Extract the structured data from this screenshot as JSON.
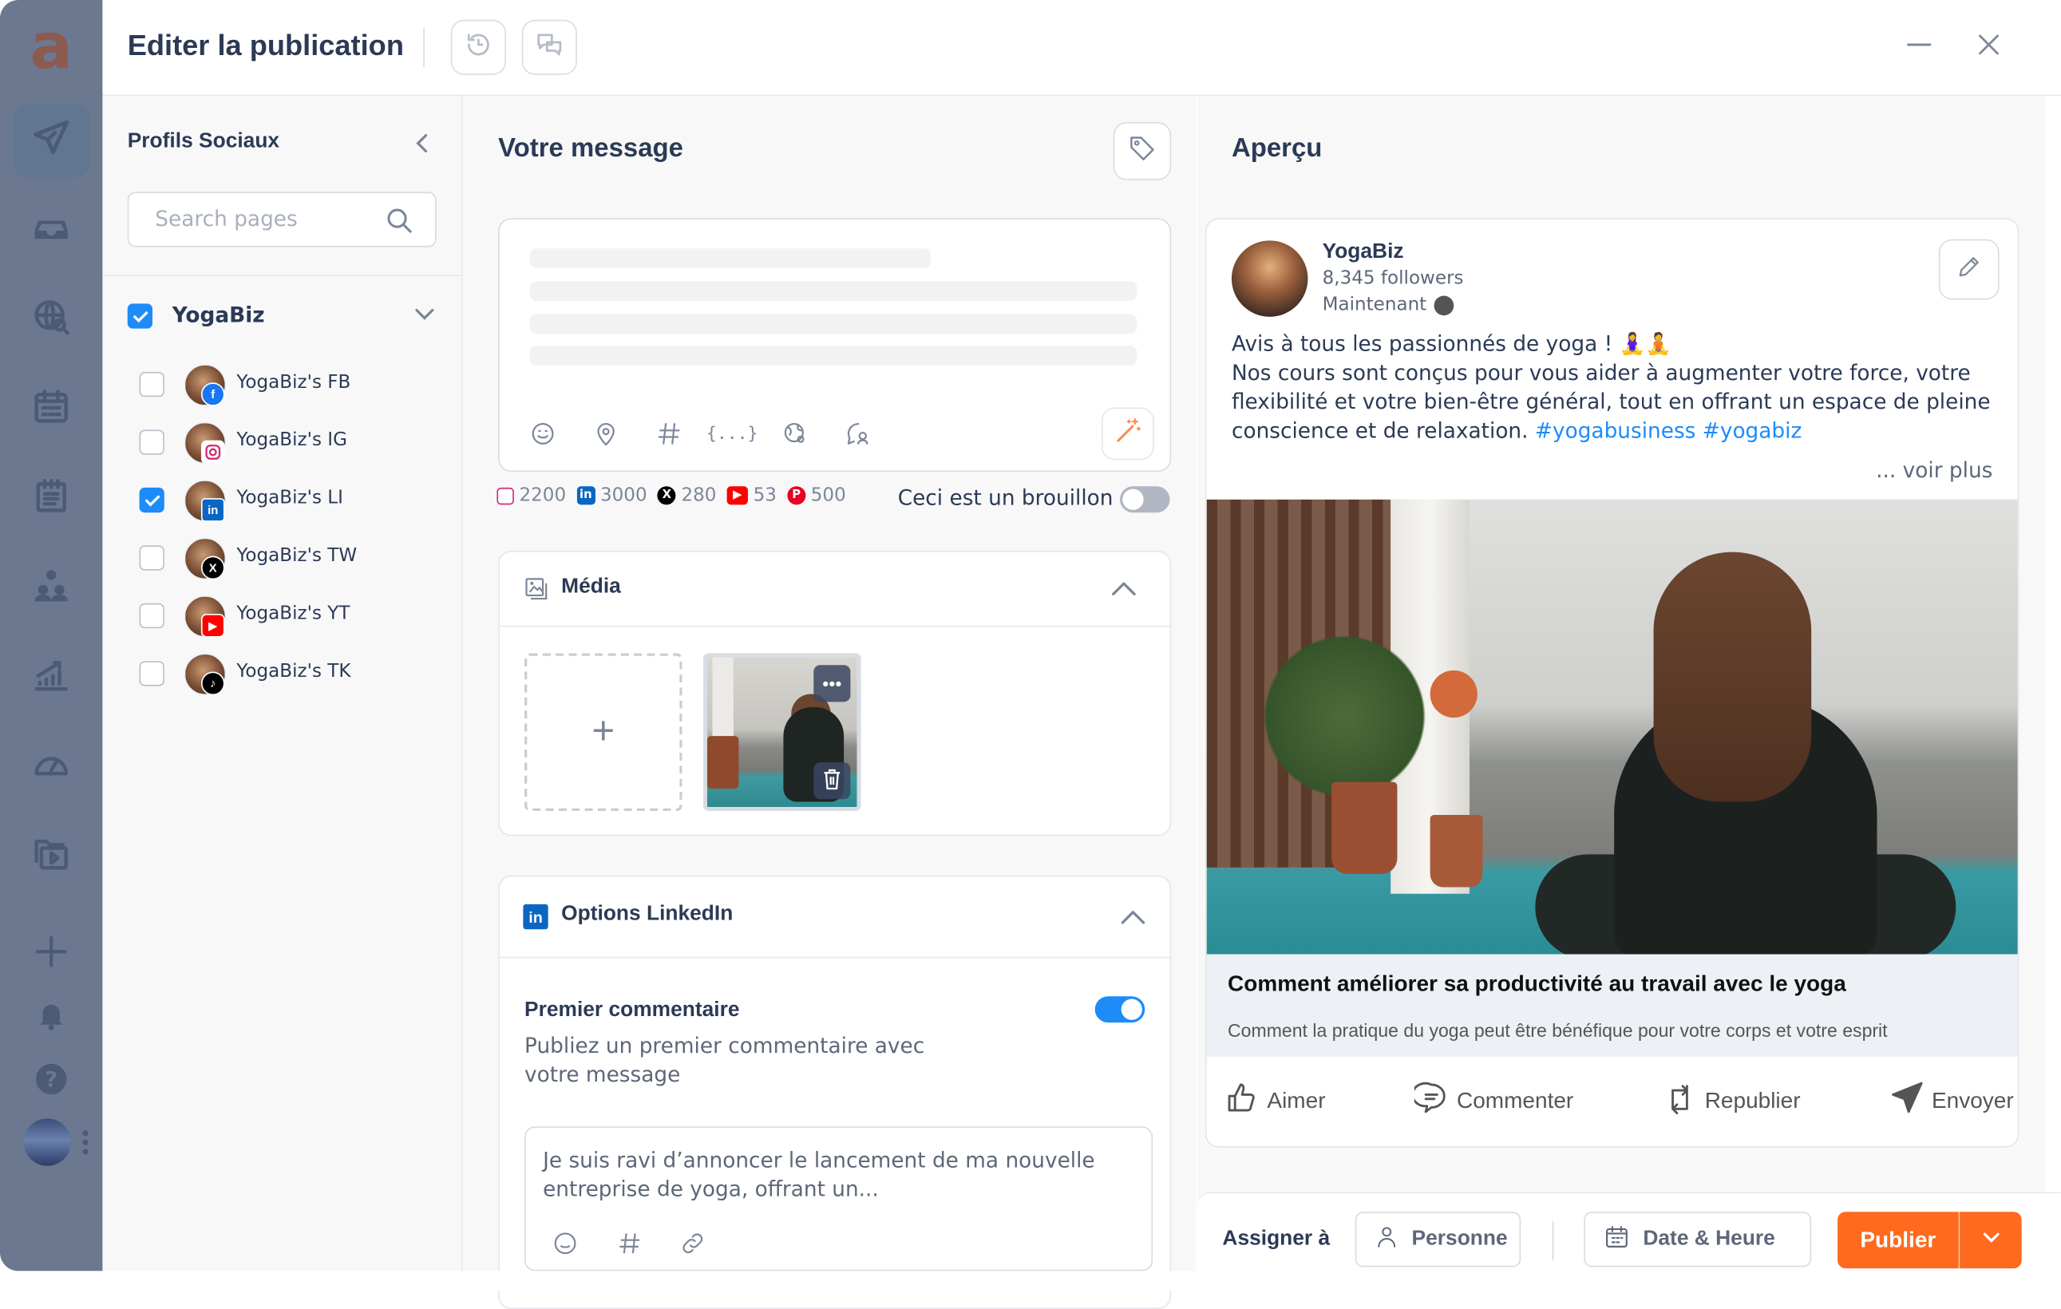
{
  "header": {
    "title": "Editer la publication",
    "history_icon": "history-icon",
    "comments_icon": "chat-bubbles-icon",
    "minimize_icon": "minimize-icon",
    "close_icon": "close-icon"
  },
  "rail": {
    "logo": "a",
    "items": [
      {
        "icon": "paper-plane-icon",
        "active": true
      },
      {
        "icon": "inbox-icon"
      },
      {
        "icon": "globe-search-icon"
      },
      {
        "icon": "calendar-icon"
      },
      {
        "icon": "notes-calendar-icon"
      },
      {
        "icon": "team-icon"
      },
      {
        "icon": "analytics-icon"
      },
      {
        "icon": "speedometer-icon"
      },
      {
        "icon": "media-library-icon"
      },
      {
        "icon": "plus-icon"
      },
      {
        "icon": "bell-icon"
      },
      {
        "icon": "help-icon"
      }
    ]
  },
  "profiles": {
    "heading": "Profils Sociaux",
    "search_placeholder": "Search pages",
    "search_value": "",
    "group": {
      "name": "YogaBiz",
      "checked": true
    },
    "items": [
      {
        "label": "YogaBiz's FB",
        "network": "facebook",
        "checked": false
      },
      {
        "label": "YogaBiz's IG",
        "network": "instagram",
        "checked": false
      },
      {
        "label": "YogaBiz's LI",
        "network": "linkedin",
        "checked": true
      },
      {
        "label": "YogaBiz's TW",
        "network": "x",
        "checked": false
      },
      {
        "label": "YogaBiz's YT",
        "network": "youtube",
        "checked": false
      },
      {
        "label": "YogaBiz's TK",
        "network": "tiktok",
        "checked": false
      }
    ]
  },
  "message": {
    "heading": "Votre message",
    "toolbar_icons": [
      "emoji-icon",
      "location-icon",
      "hashtag-icon",
      "variables-icon",
      "globe-user-icon",
      "chat-user-icon"
    ],
    "ai_icon": "magic-wand-icon",
    "limits": [
      {
        "network": "instagram",
        "value": "2200"
      },
      {
        "network": "linkedin",
        "value": "3000"
      },
      {
        "network": "x",
        "value": "280"
      },
      {
        "network": "youtube",
        "value": "53"
      },
      {
        "network": "pinterest",
        "value": "500"
      }
    ],
    "draft_label": "Ceci est un brouillon",
    "draft_on": false
  },
  "media": {
    "title": "Média",
    "add_label": "+",
    "thumb_more": "•••"
  },
  "linkedin": {
    "title": "Options LinkedIn",
    "first_comment_title": "Premier commentaire",
    "first_comment_desc": "Publiez un premier commentaire avec votre message",
    "first_comment_on": true,
    "comment_text": "Je suis ravi d’annoncer le lancement de ma nouvelle entreprise de yoga, offrant un..."
  },
  "preview": {
    "heading": "Aperçu",
    "name": "YogaBiz",
    "followers": "8,345 followers",
    "time": "Maintenant",
    "text_line1": "Avis à tous les passionnés de yoga ! 🧘‍♀️🧘",
    "text_body": "Nos cours sont conçus pour vous aider à augmenter votre force, votre flexibilité et votre bien-être général, tout en offrant un espace de pleine conscience et de relaxation.",
    "hashtags": "#yogabusiness #yogabiz",
    "see_more": "... voir plus",
    "link_title": "Comment améliorer sa productivité au travail avec le yoga",
    "link_desc": "Comment la pratique du yoga peut être bénéfique pour votre corps et votre esprit",
    "actions": [
      "Aimer",
      "Commenter",
      "Republier",
      "Envoyer"
    ]
  },
  "footer": {
    "assign_label": "Assigner à",
    "person_label": "Personne",
    "datetime_label": "Date & Heure",
    "publish_label": "Publier"
  },
  "colors": {
    "accent_blue": "#1d8cf8",
    "publish_orange": "#ff6a1f",
    "rail": "#6b7890",
    "text_dark": "#2b3a55"
  }
}
